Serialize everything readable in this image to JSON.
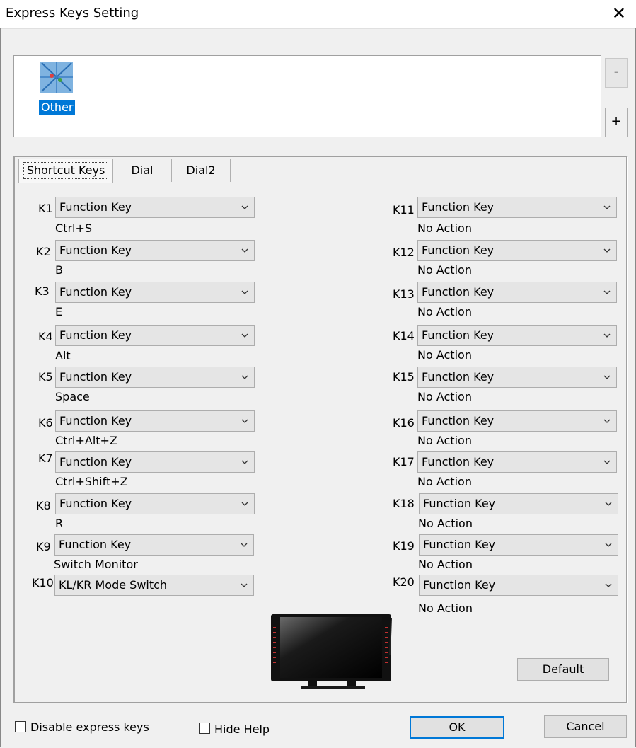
{
  "window": {
    "title": "Express Keys Setting"
  },
  "profiles": {
    "items": [
      {
        "label": "Other"
      }
    ],
    "remove_label": "-",
    "add_label": "+"
  },
  "tabs": [
    {
      "label": "Shortcut Keys"
    },
    {
      "label": "Dial"
    },
    {
      "label": "Dial2"
    }
  ],
  "keys_left": [
    {
      "key": "K1",
      "type": "Function Key",
      "value": "Ctrl+S"
    },
    {
      "key": "K2",
      "type": "Function Key",
      "value": "B"
    },
    {
      "key": "K3",
      "type": "Function Key",
      "value": "E"
    },
    {
      "key": "K4",
      "type": "Function Key",
      "value": "Alt"
    },
    {
      "key": "K5",
      "type": "Function Key",
      "value": "Space"
    },
    {
      "key": "K6",
      "type": "Function Key",
      "value": "Ctrl+Alt+Z"
    },
    {
      "key": "K7",
      "type": "Function Key",
      "value": "Ctrl+Shift+Z"
    },
    {
      "key": "K8",
      "type": "Function Key",
      "value": "R"
    },
    {
      "key": "K9",
      "type": "Function Key",
      "value": "Switch Monitor"
    },
    {
      "key": "K10",
      "type": "KL/KR Mode Switch",
      "value": ""
    }
  ],
  "keys_right": [
    {
      "key": "K11",
      "type": "Function Key",
      "value": "No Action"
    },
    {
      "key": "K12",
      "type": "Function Key",
      "value": "No Action"
    },
    {
      "key": "K13",
      "type": "Function Key",
      "value": "No Action"
    },
    {
      "key": "K14",
      "type": "Function Key",
      "value": "No Action"
    },
    {
      "key": "K15",
      "type": "Function Key",
      "value": "No Action"
    },
    {
      "key": "K16",
      "type": "Function Key",
      "value": "No Action"
    },
    {
      "key": "K17",
      "type": "Function Key",
      "value": "No Action"
    },
    {
      "key": "K18",
      "type": "Function Key",
      "value": "No Action"
    },
    {
      "key": "K19",
      "type": "Function Key",
      "value": "No Action"
    },
    {
      "key": "K20",
      "type": "Function Key",
      "value": "No Action"
    }
  ],
  "buttons": {
    "default": "Default",
    "ok": "OK",
    "cancel": "Cancel"
  },
  "options": {
    "disable_express_keys": "Disable express keys",
    "hide_help": "Hide Help"
  },
  "colors": {
    "accent": "#0078d7"
  }
}
